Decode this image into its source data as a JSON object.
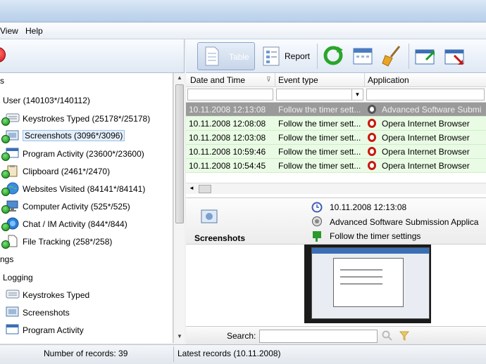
{
  "menubar": {
    "items": [
      "View",
      "Help"
    ]
  },
  "toolbar": {
    "table_label": "Table",
    "report_label": "Report"
  },
  "tree": {
    "section_partial": "s",
    "user": "User (140103*/140112)",
    "items": [
      {
        "label": "Keystrokes Typed (25178*/25178)",
        "icon": "keyboard-icon"
      },
      {
        "label": "Screenshots (3096*/3096)",
        "icon": "screenshot-icon"
      },
      {
        "label": "Program Activity (23600*/23600)",
        "icon": "program-window-icon"
      },
      {
        "label": "Clipboard (2461*/2470)",
        "icon": "clipboard-icon"
      },
      {
        "label": "Websites Visited (84141*/84141)",
        "icon": "globe-icon"
      },
      {
        "label": "Computer Activity (525*/525)",
        "icon": "computer-icon"
      },
      {
        "label": "Chat / IM Activity (844*/844)",
        "icon": "chat-icon"
      },
      {
        "label": "File Tracking (258*/258)",
        "icon": "file-icon"
      }
    ],
    "settings_partial": "ngs",
    "logging": "Logging",
    "logging_items": [
      {
        "label": "Keystrokes Typed",
        "icon": "keyboard-icon"
      },
      {
        "label": "Screenshots",
        "icon": "screenshot-icon"
      },
      {
        "label": "Program Activity",
        "icon": "program-window-icon"
      }
    ]
  },
  "grid": {
    "columns": [
      "Date and Time",
      "Event type",
      "Application"
    ],
    "rows": [
      {
        "date": "10.11.2008 12:13:08",
        "event": "Follow the timer sett...",
        "app": "Advanced Software Submi"
      },
      {
        "date": "10.11.2008 12:08:08",
        "event": "Follow the timer sett...",
        "app": "Opera Internet Browser"
      },
      {
        "date": "10.11.2008 12:03:08",
        "event": "Follow the timer sett...",
        "app": "Opera Internet Browser"
      },
      {
        "date": "10.11.2008 10:59:46",
        "event": "Follow the timer sett...",
        "app": "Opera Internet Browser"
      },
      {
        "date": "10.11.2008 10:54:45",
        "event": "Follow the timer sett...",
        "app": "Opera Internet Browser"
      }
    ]
  },
  "detail": {
    "category": "Screenshots",
    "datetime": "10.11.2008 12:13:08",
    "application": "Advanced Software Submission Applica",
    "event": "Follow the timer settings"
  },
  "search": {
    "label": "Search:"
  },
  "status": {
    "records": "Number of records: 39",
    "latest": "Latest records (10.11.2008)"
  },
  "colors": {
    "row_green": "#e9fbe4",
    "row_selected": "#9a9a9a",
    "accent_blue": "#2f6fbf"
  }
}
